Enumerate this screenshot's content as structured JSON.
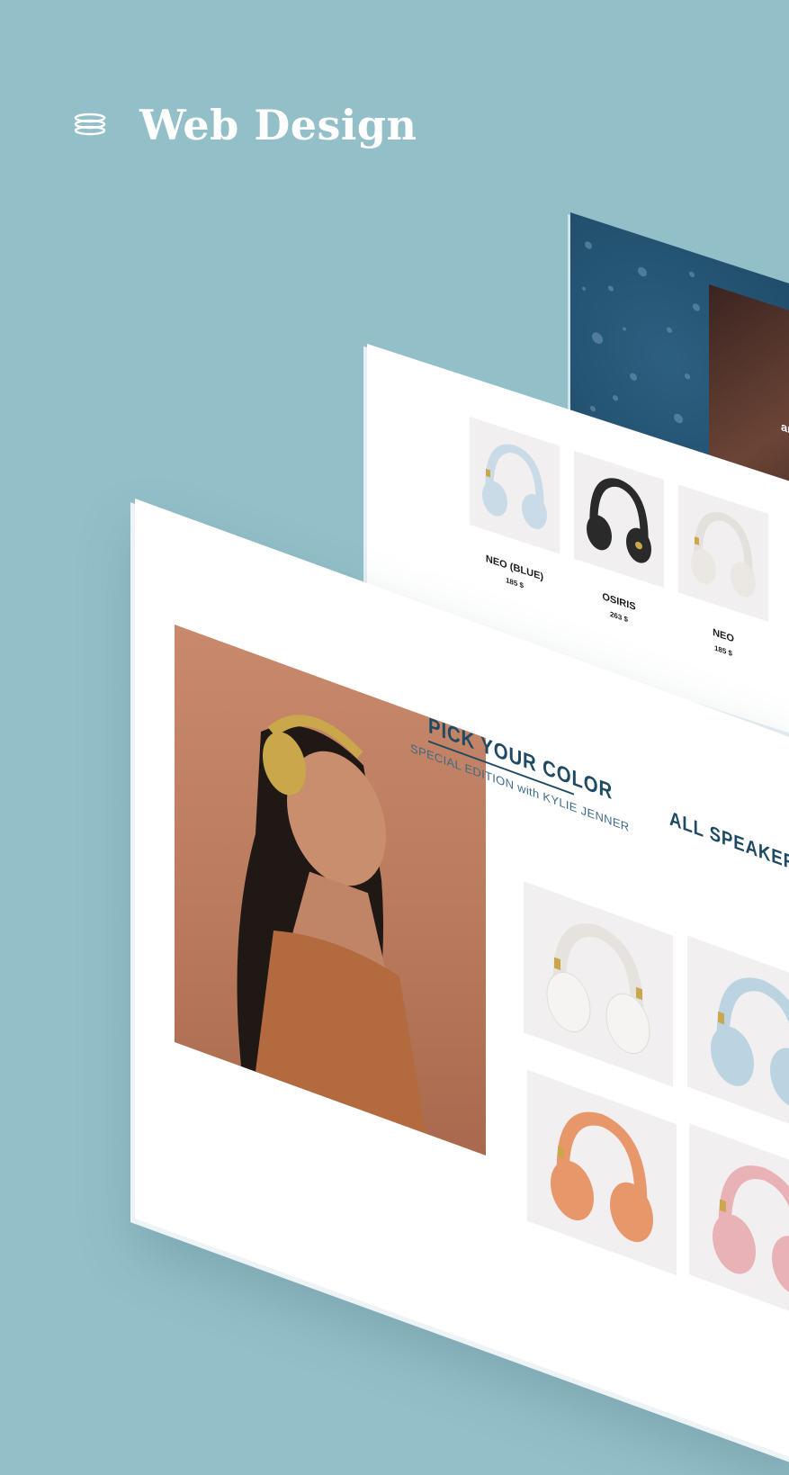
{
  "header": {
    "title": "Web Design",
    "icon": "stacked-layers-icon"
  },
  "rain_panel": {
    "photo_text": "ar"
  },
  "products_row": [
    {
      "name": "NEO (BLUE)",
      "price": "185 $",
      "color": "#c9dbe6"
    },
    {
      "name": "OSIRIS",
      "price": "263 $",
      "color": "#2a2a2a"
    },
    {
      "name": "NEO",
      "price": "185 $",
      "color": "#ebe8e4"
    }
  ],
  "front": {
    "pick_title": "PICK YOUR COLOR",
    "pick_subtitle": "SPECIAL EDITION with KYLIE JENNER",
    "speakers_title": "ALL SPEAKERS",
    "tiles": [
      {
        "color": "#f2f0ee"
      },
      {
        "color": "#bcd4e2"
      },
      {
        "color": "#e8976b"
      },
      {
        "color": "#e9b2b6"
      }
    ]
  },
  "colors": {
    "background": "#93bfc9",
    "accent": "#1f4a63",
    "hero_bg": "#b97a5d",
    "gold": "#c9a74a"
  }
}
